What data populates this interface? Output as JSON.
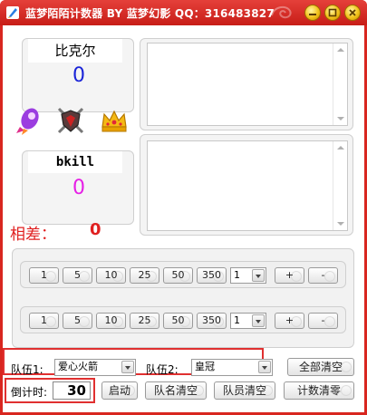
{
  "window": {
    "title": "蓝梦陌陌计数器 BY 蓝梦幻影 QQ：316483827"
  },
  "team1": {
    "name": "比克尔",
    "score": "0",
    "score_color": "#1a24d8"
  },
  "team2": {
    "name": "bkill",
    "score": "0",
    "score_color": "#e61ee6"
  },
  "difference": {
    "label": "相差：",
    "value": "0",
    "color": "#e02020"
  },
  "row1": {
    "buttons": [
      "1",
      "5",
      "10",
      "25",
      "50",
      "350"
    ],
    "select_value": "1",
    "plus": "+",
    "minus": "-"
  },
  "row2": {
    "buttons": [
      "1",
      "5",
      "10",
      "25",
      "50",
      "350"
    ],
    "select_value": "1",
    "plus": "+",
    "minus": "-"
  },
  "bottom": {
    "team1_label": "队伍1:",
    "team1_value": "爱心火箭",
    "team2_label": "队伍2:",
    "team2_value": "皇冠",
    "clear_all": "全部清空",
    "countdown_label": "倒计时:",
    "countdown_value": "30",
    "start": "启动",
    "clear_names": "队名清空",
    "clear_members": "队员清空",
    "clear_count": "计数清零"
  },
  "icons": {
    "left": "rocket-icon",
    "middle": "shield-swords-icon",
    "right": "crown-icon"
  },
  "colors": {
    "title_bar": "#d8261f",
    "accent_red": "#e03030"
  }
}
